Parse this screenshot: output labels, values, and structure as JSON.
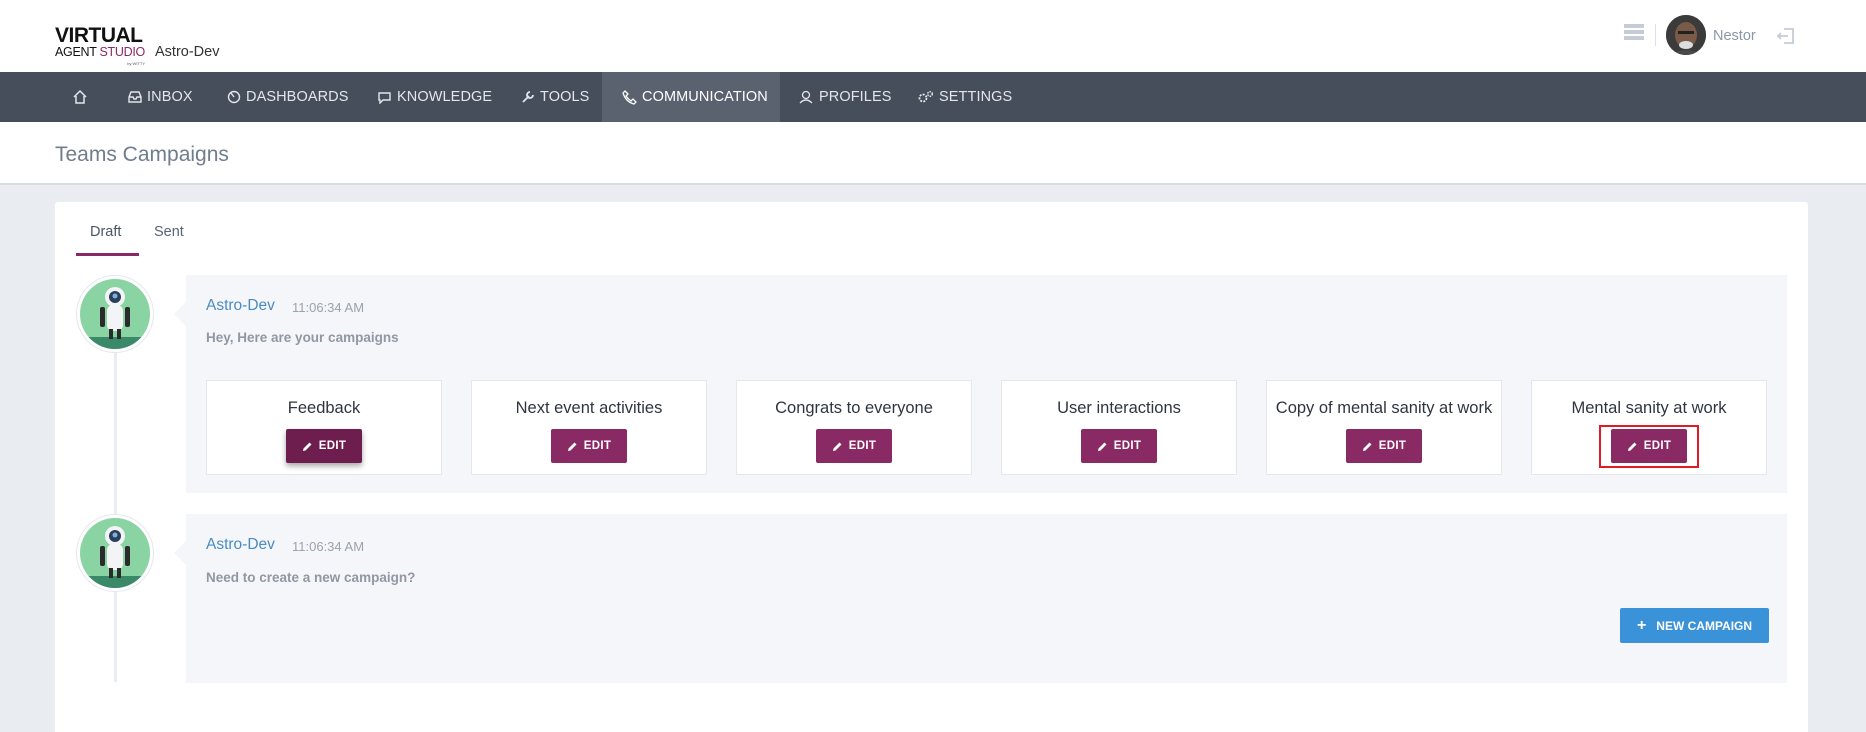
{
  "header": {
    "logo_line1": "VIRTUAL",
    "logo_line2a": "AGENT ",
    "logo_line2b": "STUDIO",
    "logo_line3": "by WITTY",
    "app_name": "Astro-Dev",
    "user_name": "Nestor"
  },
  "nav": {
    "items": [
      {
        "label": "",
        "icon": "home-icon"
      },
      {
        "label": "INBOX",
        "icon": "inbox-icon"
      },
      {
        "label": "DASHBOARDS",
        "icon": "dashboard-icon"
      },
      {
        "label": "KNOWLEDGE",
        "icon": "chat-icon"
      },
      {
        "label": "TOOLS",
        "icon": "wrench-icon"
      },
      {
        "label": "COMMUNICATION",
        "icon": "phone-icon",
        "active": true
      },
      {
        "label": "PROFILES",
        "icon": "profiles-icon"
      },
      {
        "label": "SETTINGS",
        "icon": "gears-icon"
      }
    ]
  },
  "page": {
    "title": "Teams Campaigns"
  },
  "tabs": {
    "draft": "Draft",
    "sent": "Sent"
  },
  "messages": [
    {
      "sender": "Astro-Dev",
      "time": "11:06:34 AM",
      "text": "Hey, Here are your campaigns",
      "campaigns": [
        {
          "title": "Feedback",
          "button": "EDIT"
        },
        {
          "title": "Next event activities",
          "button": "EDIT"
        },
        {
          "title": "Congrats to everyone",
          "button": "EDIT"
        },
        {
          "title": "User interactions",
          "button": "EDIT"
        },
        {
          "title": "Copy of mental sanity at work",
          "button": "EDIT"
        },
        {
          "title": "Mental sanity at work",
          "button": "EDIT"
        }
      ]
    },
    {
      "sender": "Astro-Dev",
      "time": "11:06:34 AM",
      "text": "Need to create a new campaign?",
      "button": "NEW CAMPAIGN"
    }
  ],
  "colors": {
    "nav_bg": "#474e5b",
    "accent": "#8a2a64",
    "link": "#4a8bc2",
    "primary_button": "#3a93d8",
    "highlight": "#e01b24"
  }
}
